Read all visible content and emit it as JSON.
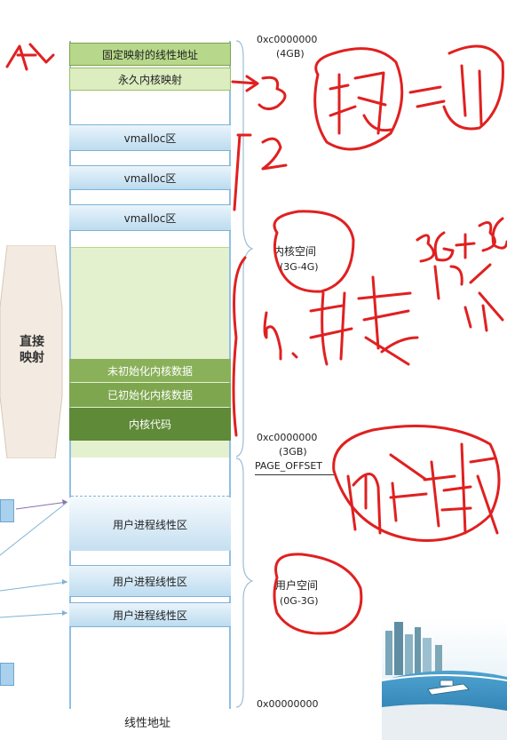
{
  "segments": {
    "fixed_map": "固定映射的线性地址",
    "permanent_map": "永久内核映射",
    "vmalloc1": "vmalloc区",
    "vmalloc2": "vmalloc区",
    "vmalloc3": "vmalloc区",
    "uninit_data": "未初始化内核数据",
    "init_data": "已初始化内核数据",
    "kernel_code": "内核代码",
    "user_area1": "用户进程线性区",
    "user_area2": "用户进程线性区",
    "user_area3": "用户进程线性区"
  },
  "bottom_label": "线性地址",
  "left_label": {
    "line1": "直接",
    "line2": "映射"
  },
  "addresses": {
    "top_addr": "0xc0000000",
    "top_size": "(4GB)",
    "mid_addr": "0xc0000000",
    "mid_size": "(3GB)",
    "page_offset": "PAGE_OFFSET",
    "bottom_addr": "0x00000000"
  },
  "spaces": {
    "kernel": "内核空间",
    "kernel_range": "(3G-4G)",
    "user": "用户空间",
    "user_range": "(0G-3G)"
  },
  "colors": {
    "ink": "#e02020",
    "blue": "#bcdcf0",
    "green": "#dcedbf",
    "dark_green": "#5f8a38"
  }
}
